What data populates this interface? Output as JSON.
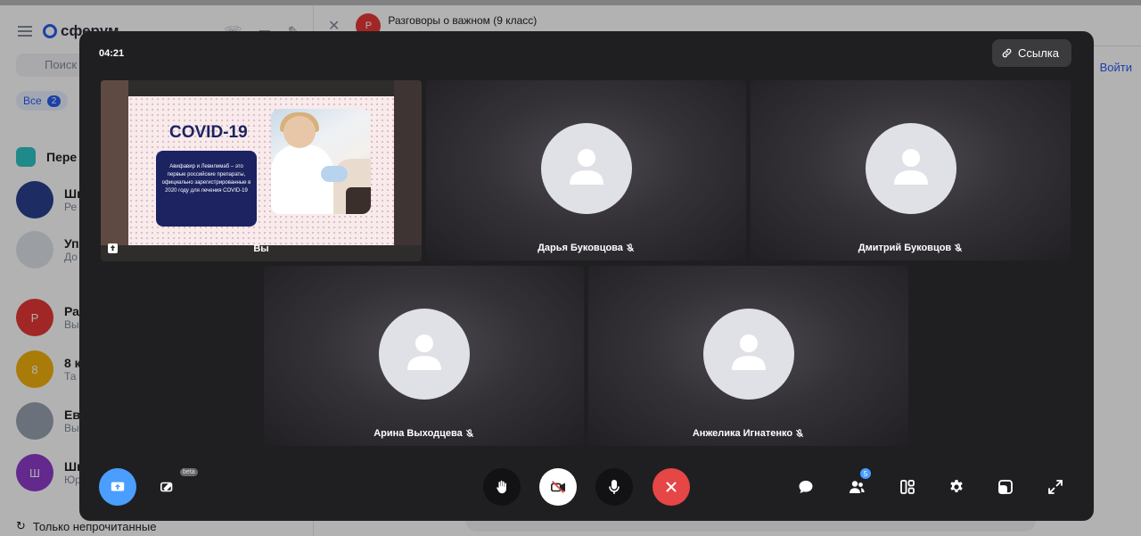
{
  "background": {
    "logo_text": "сферум",
    "search_placeholder": "Поиск",
    "filter": {
      "label": "Все",
      "count": "2"
    },
    "chat_items": [
      {
        "initial": "",
        "title": "Шк",
        "subtitle": "Ре",
        "color": "#2a3f8f"
      },
      {
        "initial": "",
        "title": "Упр",
        "subtitle": "До",
        "color": "#dfe3ea"
      },
      {
        "initial": "Р",
        "title": "Раз",
        "subtitle": "Вы",
        "color": "#e53935"
      },
      {
        "initial": "8",
        "title": "8 к",
        "subtitle": "Та",
        "color": "#f2b10c"
      },
      {
        "initial": "",
        "title": "Евг",
        "subtitle": "Вы",
        "color": "#9aa3b0"
      },
      {
        "initial": "Ш",
        "title": "Шк",
        "subtitle": "Юр",
        "color": "#8e3ccb"
      }
    ],
    "section_label": "Пере",
    "unread_toggle_label": "Только непрочитанные",
    "chat_header": {
      "avatar_initial": "Р",
      "title": "Разговоры о важном (9 класс)"
    },
    "login_link": "Войти"
  },
  "call": {
    "timer": "04:21",
    "link_button_label": "Ссылка",
    "screen_share": {
      "owner_label": "Вы",
      "slide_title": "COVID-19",
      "slide_text": "Авифавир и Левилимаб – это первые российские препараты, официально зарегистрированные в 2020 году для лечения COVID-19"
    },
    "participants": [
      {
        "name": "Дарья Буковцова",
        "muted": true
      },
      {
        "name": "Дмитрий Буковцов",
        "muted": true
      },
      {
        "name": "Арина Выходцева",
        "muted": true
      },
      {
        "name": "Анжелика Игнатенко",
        "muted": true
      }
    ],
    "controls": {
      "beta_label": "beta",
      "participants_count": "5"
    },
    "colors": {
      "accent": "#4a9eff",
      "end_call": "#e64646",
      "window_bg": "#1f1f21"
    }
  }
}
